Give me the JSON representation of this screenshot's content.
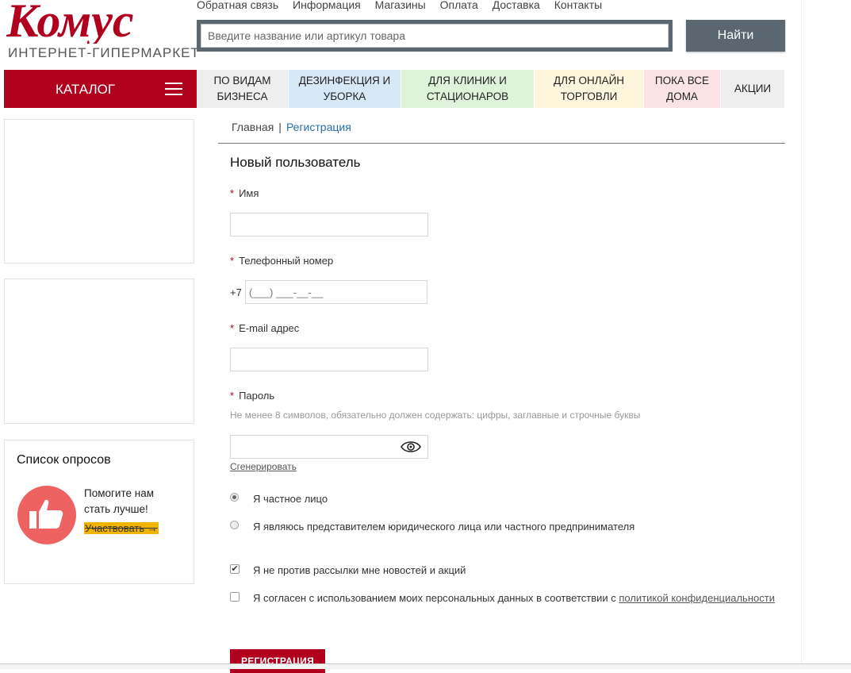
{
  "header": {
    "logo_text": "Комус",
    "logo_subtitle": "ИНТЕРНЕТ-ГИПЕРМАРКЕТ",
    "top_links": [
      "Обратная связь",
      "Информация",
      "Магазины",
      "Оплата",
      "Доставка",
      "Контакты"
    ],
    "search_placeholder": "Введите название или артикул товара",
    "search_button": "Найти"
  },
  "nav": {
    "catalog_label": "КАТАЛОГ",
    "items": [
      {
        "label": "ПО ВИДАМ БИЗНЕСА",
        "color": "#eeeeee"
      },
      {
        "label": "ДЕЗИНФЕКЦИЯ И УБОРКА",
        "color": "#d7e8f7"
      },
      {
        "label": "ДЛЯ КЛИНИК И СТАЦИОНАРОВ",
        "color": "#dff3da"
      },
      {
        "label": "ДЛЯ ОНЛАЙН ТОРГОВЛИ",
        "color": "#fdf6dd"
      },
      {
        "label": "ПОКА ВСЕ ДОМА",
        "color": "#fbe3e6"
      },
      {
        "label": "АКЦИИ",
        "color": "#eeeeee"
      }
    ]
  },
  "sidebar": {
    "polls_title": "Список опросов",
    "polls_text": "Помогите нам стать лучше!",
    "polls_link": "Участвовать →"
  },
  "breadcrumb": {
    "home": "Главная",
    "separator": "|",
    "current": "Регистрация"
  },
  "form": {
    "title": "Новый пользователь",
    "required_mark": "*",
    "name_label": "Имя",
    "name_value": "",
    "phone_label": "Телефонный номер",
    "phone_prefix": "+7",
    "phone_placeholder": "(___) ___-__-__",
    "email_label": "E-mail адрес",
    "email_value": "",
    "password_label": "Пароль",
    "password_hint": "Не менее 8 символов, обязательно должен содержать: цифры, заглавные и строчные буквы",
    "password_value": "",
    "generate_link": "Сгенерировать",
    "radio_private": "Я частное лицо",
    "radio_private_selected": true,
    "radio_company": "Я являюсь представителем юридического лица или частного предпринимателя",
    "radio_company_selected": false,
    "newsletter_label": "Я не против рассылки мне новостей и акций",
    "newsletter_checked": true,
    "consent_label": "Я согласен с использованием моих персональных данных в соответствии с ",
    "consent_link": "политикой конфиденциальности",
    "consent_checked": false,
    "submit": "РЕГИСТРАЦИЯ"
  },
  "colors": {
    "brand": "#b1001e",
    "search": "#5b6770",
    "link": "#2a6fa8",
    "polls_accent": "#ee6262"
  }
}
